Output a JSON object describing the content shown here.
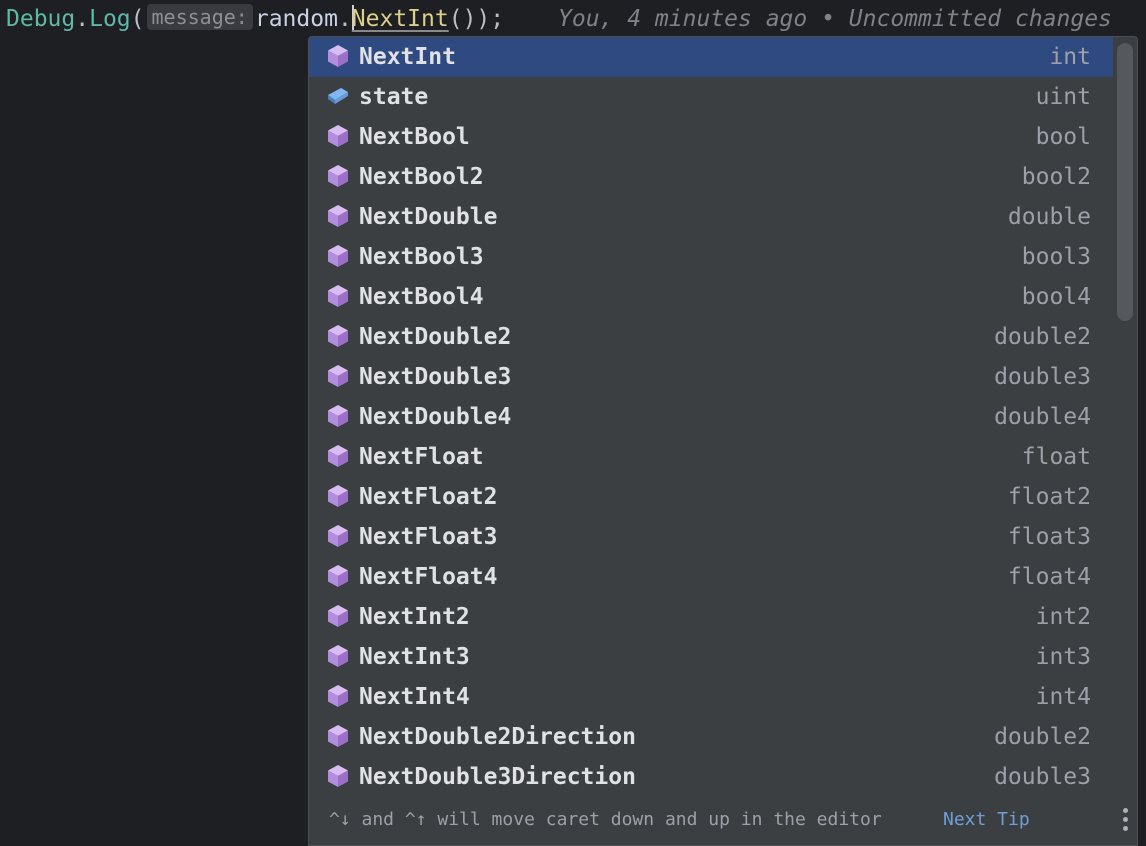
{
  "editor": {
    "code": {
      "class_name": "Debug",
      "dot1": ".",
      "method": "Log",
      "open_paren": "(",
      "param_hint": "message:",
      "receiver": "random",
      "dot2": ".",
      "call": "NextInt",
      "tail": "());"
    },
    "blame": "You, 4 minutes ago • Uncommitted changes"
  },
  "completion": {
    "items": [
      {
        "name": "NextInt",
        "type": "int",
        "icon": "method-icon",
        "selected": true
      },
      {
        "name": "state",
        "type": "uint",
        "icon": "field-icon",
        "selected": false
      },
      {
        "name": "NextBool",
        "type": "bool",
        "icon": "method-icon",
        "selected": false
      },
      {
        "name": "NextBool2",
        "type": "bool2",
        "icon": "method-icon",
        "selected": false
      },
      {
        "name": "NextDouble",
        "type": "double",
        "icon": "method-icon",
        "selected": false
      },
      {
        "name": "NextBool3",
        "type": "bool3",
        "icon": "method-icon",
        "selected": false
      },
      {
        "name": "NextBool4",
        "type": "bool4",
        "icon": "method-icon",
        "selected": false
      },
      {
        "name": "NextDouble2",
        "type": "double2",
        "icon": "method-icon",
        "selected": false
      },
      {
        "name": "NextDouble3",
        "type": "double3",
        "icon": "method-icon",
        "selected": false
      },
      {
        "name": "NextDouble4",
        "type": "double4",
        "icon": "method-icon",
        "selected": false
      },
      {
        "name": "NextFloat",
        "type": "float",
        "icon": "method-icon",
        "selected": false
      },
      {
        "name": "NextFloat2",
        "type": "float2",
        "icon": "method-icon",
        "selected": false
      },
      {
        "name": "NextFloat3",
        "type": "float3",
        "icon": "method-icon",
        "selected": false
      },
      {
        "name": "NextFloat4",
        "type": "float4",
        "icon": "method-icon",
        "selected": false
      },
      {
        "name": "NextInt2",
        "type": "int2",
        "icon": "method-icon",
        "selected": false
      },
      {
        "name": "NextInt3",
        "type": "int3",
        "icon": "method-icon",
        "selected": false
      },
      {
        "name": "NextInt4",
        "type": "int4",
        "icon": "method-icon",
        "selected": false
      },
      {
        "name": "NextDouble2Direction",
        "type": "double2",
        "icon": "method-icon",
        "selected": false
      },
      {
        "name": "NextDouble3Direction",
        "type": "double3",
        "icon": "method-icon",
        "selected": false
      }
    ],
    "footer": {
      "hint": "^↓ and ^↑ will move caret down and up in the editor",
      "next_tip": "Next Tip",
      "menu_icon": "more-vertical-icon"
    }
  },
  "colors": {
    "method_icon": "#b48ede",
    "field_icon": "#7fb7f0",
    "selection": "#2f4a80",
    "link": "#6f9fd8"
  }
}
